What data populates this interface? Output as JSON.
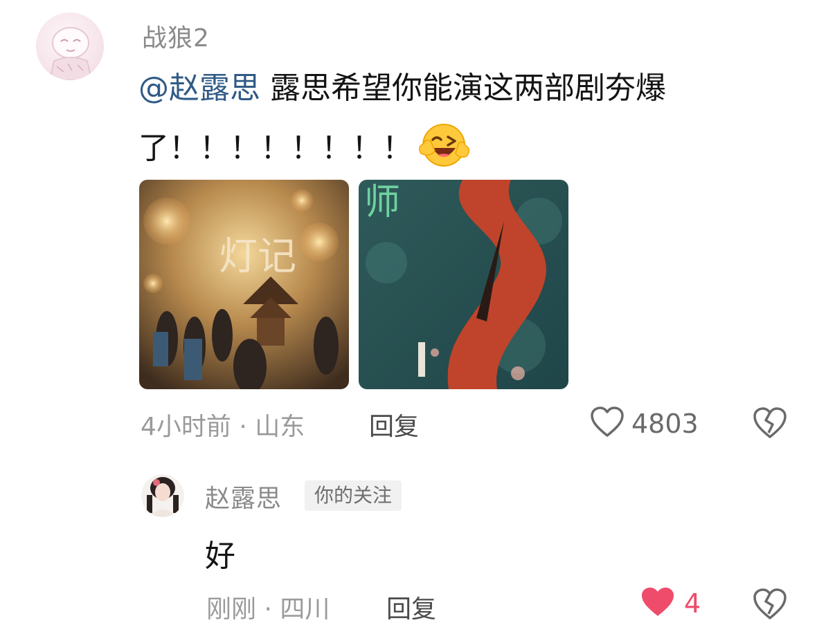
{
  "comment": {
    "username": "战狼2",
    "mention": "@赵露思",
    "text_line1": "露思希望你能演这两部剧夯爆",
    "text_line2": "了！！！！！！！！",
    "emoji": "grinning-winking-face-emoji",
    "images": [
      {
        "caption": "灯记"
      },
      {
        "caption": "师"
      }
    ],
    "meta": "4小时前 · 山东",
    "reply_label": "回复",
    "like_count": "4803",
    "liked": false
  },
  "reply": {
    "username": "赵露思",
    "badge": "你的关注",
    "text": "好",
    "meta": "刚刚 · 四川",
    "reply_label": "回复",
    "like_count": "4",
    "liked": true
  },
  "colors": {
    "mention": "#2f5a86",
    "like_active": "#ef4b6b",
    "muted_text": "#8a8a8a"
  }
}
